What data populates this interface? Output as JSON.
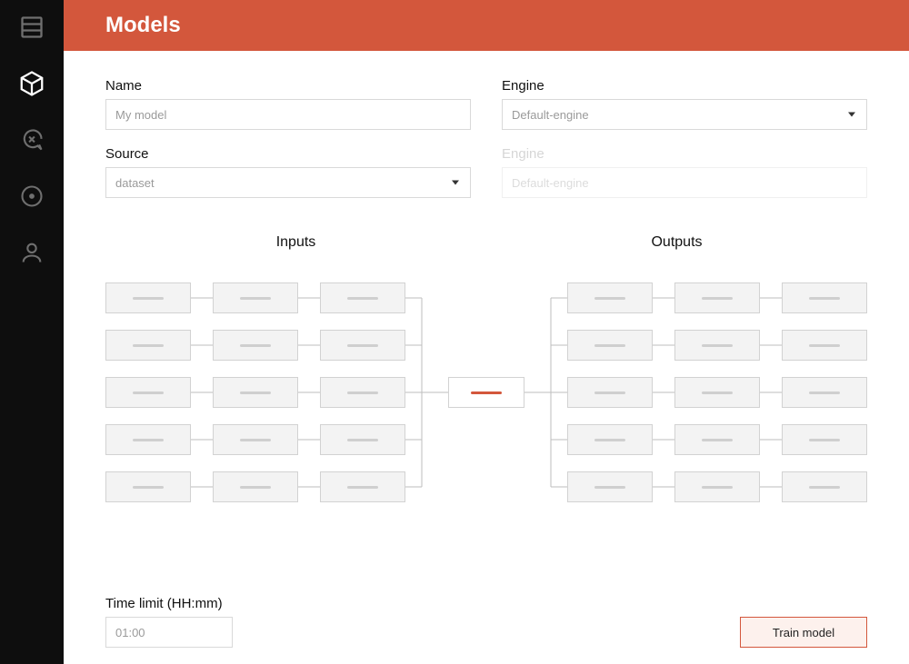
{
  "header": {
    "title": "Models"
  },
  "form": {
    "name_label": "Name",
    "name_placeholder": "My model",
    "engine_label": "Engine",
    "engine_value": "Default-engine",
    "source_label": "Source",
    "source_value": "dataset",
    "engine2_label": "Engine",
    "engine2_value": "Default-engine"
  },
  "diagram": {
    "inputs_title": "Inputs",
    "outputs_title": "Outputs",
    "input_rows": 5,
    "output_rows": 5,
    "cols_per_side": 3
  },
  "footer": {
    "time_label": "Time limit (HH:mm)",
    "time_placeholder": "01:00",
    "train_label": "Train model"
  },
  "colors": {
    "accent": "#d3573c",
    "sidebar": "#0e0e0e"
  }
}
